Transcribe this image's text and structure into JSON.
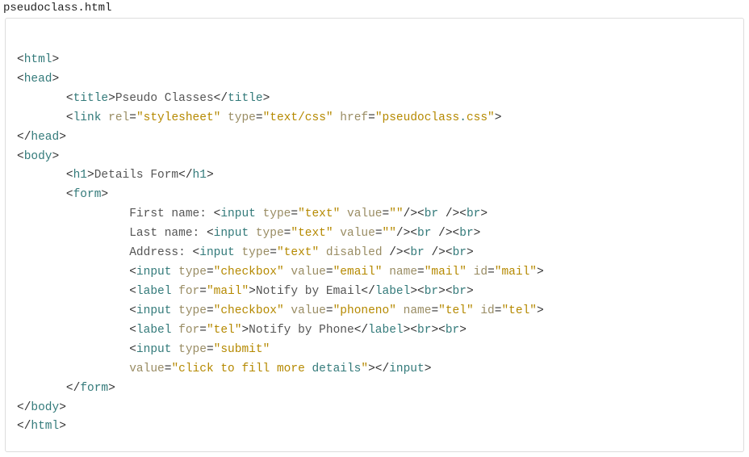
{
  "filename": "pseudoclass.html",
  "t": {
    "html": "html",
    "head": "head",
    "title": "title",
    "link": "link",
    "body": "body",
    "h1": "h1",
    "form": "form",
    "input": "input",
    "label": "label",
    "br": "br"
  },
  "attr": {
    "rel": "rel",
    "type": "type",
    "href": "href",
    "value": "value",
    "disabled": "disabled",
    "name": "name",
    "id": "id",
    "for": "for"
  },
  "str": {
    "titletext": "Pseudo Classes",
    "stylesheet": "\"stylesheet\"",
    "textcss": "\"text/css\"",
    "href_pfx": "\"pseudoclass",
    "href_dot": ".",
    "href_css": "css\"",
    "h1text": "Details Form",
    "firstname": "First name: ",
    "lastname": "Last name: ",
    "address": "Address: ",
    "text": "\"text\"",
    "empty": "\"\"",
    "checkbox": "\"checkbox\"",
    "email": "\"email\"",
    "mail": "\"mail\"",
    "notifyemail": "Notify by Email",
    "phoneno": "\"phoneno\"",
    "tel": "\"tel\"",
    "notifyphone": "Notify by Phone",
    "submit": "\"submit\"",
    "clickfill": "\"click to fill more ",
    "details": "details",
    "endq": "\""
  }
}
